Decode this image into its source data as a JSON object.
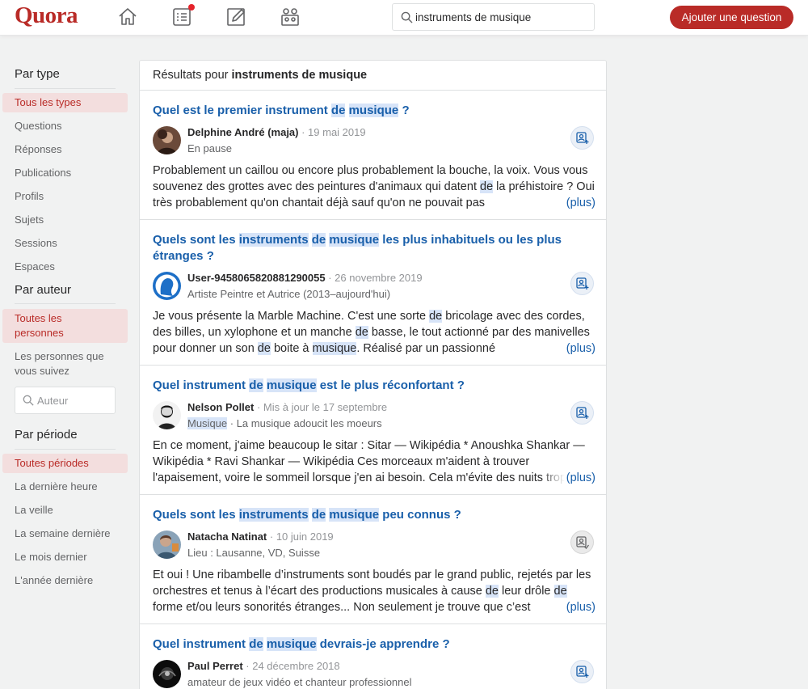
{
  "header": {
    "logo": "Quora",
    "search_value": "instruments de musique",
    "ask_label": "Ajouter une question"
  },
  "colors": {
    "brand": "#b92b27",
    "link": "#195faa",
    "highlight": "#d7e4f8"
  },
  "sidebar": {
    "type_heading": "Par type",
    "type_items": [
      "Tous les types",
      "Questions",
      "Réponses",
      "Publications",
      "Profils",
      "Sujets",
      "Sessions",
      "Espaces"
    ],
    "author_heading": "Par auteur",
    "author_items": [
      "Toutes les personnes",
      "Les personnes que vous suivez"
    ],
    "author_placeholder": "Auteur",
    "period_heading": "Par période",
    "period_items": [
      "Toutes périodes",
      "La dernière heure",
      "La veille",
      "La semaine dernière",
      "Le mois dernier",
      "L'année dernière"
    ]
  },
  "results": {
    "prefix": "Résultats pour",
    "query": "instruments de musique",
    "more_label": "(plus)",
    "items": [
      {
        "title_parts": [
          "Quel est le premier instrument ",
          "de",
          " ",
          "musique",
          " ?"
        ],
        "author": "Delphine André (maja)",
        "date": "· 19 mai 2019",
        "credential": "En pause",
        "excerpt_parts": [
          "Probablement un caillou ou encore plus probablement la bouche, la voix. Vous vous souvenez des grottes avec des peintures d'animaux qui datent ",
          "de",
          " la préhistoire ? Oui très probablement qu'on chantait déjà sauf qu'on ne pouvait pas"
        ]
      },
      {
        "title_parts": [
          "Quels sont les ",
          "instruments",
          " ",
          "de",
          " ",
          "musique",
          " les plus inhabituels ou les plus étranges ?"
        ],
        "author": "User-9458065820881290055",
        "date": "· 26 novembre 2019",
        "credential": "Artiste Peintre et Autrice (2013–aujourd'hui)",
        "excerpt_parts": [
          "Je vous présente la Marble Machine. C'est une sorte ",
          "de",
          " bricolage avec des cordes, des billes, un xylophone et un manche ",
          "de",
          " basse, le tout actionné par des manivelles pour donner un son ",
          "de",
          " boite à ",
          "musique",
          ". Réalisé par un passionné"
        ]
      },
      {
        "title_parts": [
          "Quel instrument ",
          "de",
          " ",
          "musique",
          " est le plus réconfortant ?"
        ],
        "author": "Nelson Pollet",
        "date": "· Mis à jour le 17 septembre",
        "credential_topic": "Musique",
        "credential": " · La musique adoucit les moeurs",
        "excerpt_parts": [
          "En ce moment, j'aime beaucoup le sitar : Sitar — Wikipédia * Anoushka Shankar — Wikipédia * Ravi Shankar — Wikipédia Ces morceaux m'aident à trouver l'apaisement, voire le sommeil lorsque j'en ai besoin. Cela m'évite des nuits trop"
        ]
      },
      {
        "title_parts": [
          "Quels sont les ",
          "instruments",
          " ",
          "de",
          " ",
          "musique",
          " peu connus ?"
        ],
        "author": "Natacha Natinat",
        "date": "· 10 juin 2019",
        "credential": "Lieu : Lausanne, VD, Suisse",
        "excerpt_parts": [
          "Et oui ! Une ribambelle d’instruments sont boudés par le grand public, rejetés par les orchestres et tenus à l’écart des productions musicales à cause ",
          "de",
          " leur drôle ",
          "de",
          " forme et/ou leurs sonorités étranges... Non seulement je trouve que c’est"
        ]
      },
      {
        "title_parts": [
          "Quel instrument ",
          "de",
          " ",
          "musique",
          " devrais-je apprendre ?"
        ],
        "author": "Paul Perret",
        "date": "· 24 décembre 2018",
        "credential": "amateur de jeux vidéo et chanteur professionnel"
      }
    ]
  }
}
